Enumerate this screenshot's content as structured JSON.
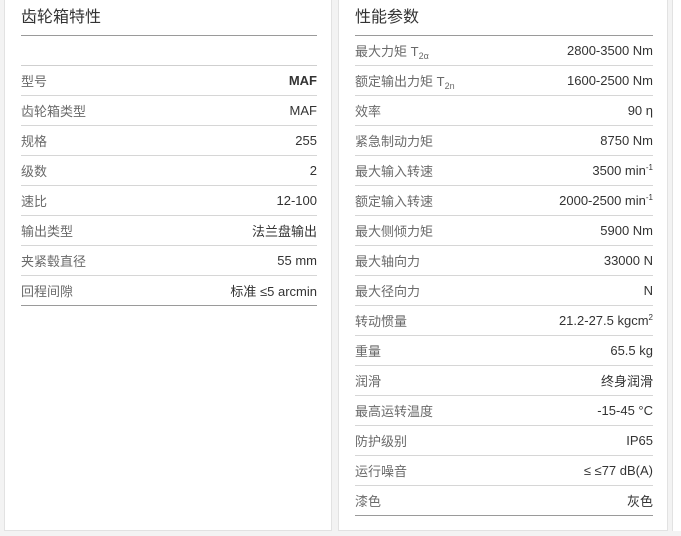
{
  "left_panel": {
    "title": "齿轮箱特性",
    "rows": [
      {
        "label": "型号",
        "value": "MAF"
      },
      {
        "label": "齿轮箱类型",
        "value": "MAF"
      },
      {
        "label": "规格",
        "value": "255"
      },
      {
        "label": "级数",
        "value": "2"
      },
      {
        "label": "速比",
        "value": "12-100"
      },
      {
        "label": "输出类型",
        "value": "法兰盘输出"
      },
      {
        "label": "夹紧毂直径",
        "value": "55 mm"
      },
      {
        "label": "回程间隙",
        "value": "标准 ≤5 arcmin"
      }
    ]
  },
  "right_panel": {
    "title": "性能参数",
    "rows": [
      {
        "label": "最大力矩 T",
        "label_sub": "2α",
        "value": "2800-3500 Nm"
      },
      {
        "label": "额定输出力矩 T",
        "label_sub": "2n",
        "value": "1600-2500 Nm"
      },
      {
        "label": "效率",
        "value": "90 η"
      },
      {
        "label": "紧急制动力矩",
        "value": "8750 Nm"
      },
      {
        "label": "最大输入转速",
        "value": "3500 min",
        "value_sup": "-1"
      },
      {
        "label": "额定输入转速",
        "value": "2000-2500 min",
        "value_sup": "-1"
      },
      {
        "label": "最大侧倾力矩",
        "value": "5900 Nm"
      },
      {
        "label": "最大轴向力",
        "value": "33000 N"
      },
      {
        "label": "最大径向力",
        "value": "N"
      },
      {
        "label": "转动惯量",
        "value": "21.2-27.5 kgcm",
        "value_sup": "2"
      },
      {
        "label": "重量",
        "value": "65.5 kg"
      },
      {
        "label": "润滑",
        "value": "终身润滑"
      },
      {
        "label": "最高运转温度",
        "value": "-15-45 °C"
      },
      {
        "label": "防护级别",
        "value": "IP65"
      },
      {
        "label": "运行噪音",
        "value": "≤ ≤77 dB(A)"
      },
      {
        "label": "漆色",
        "value": "灰色"
      }
    ]
  }
}
